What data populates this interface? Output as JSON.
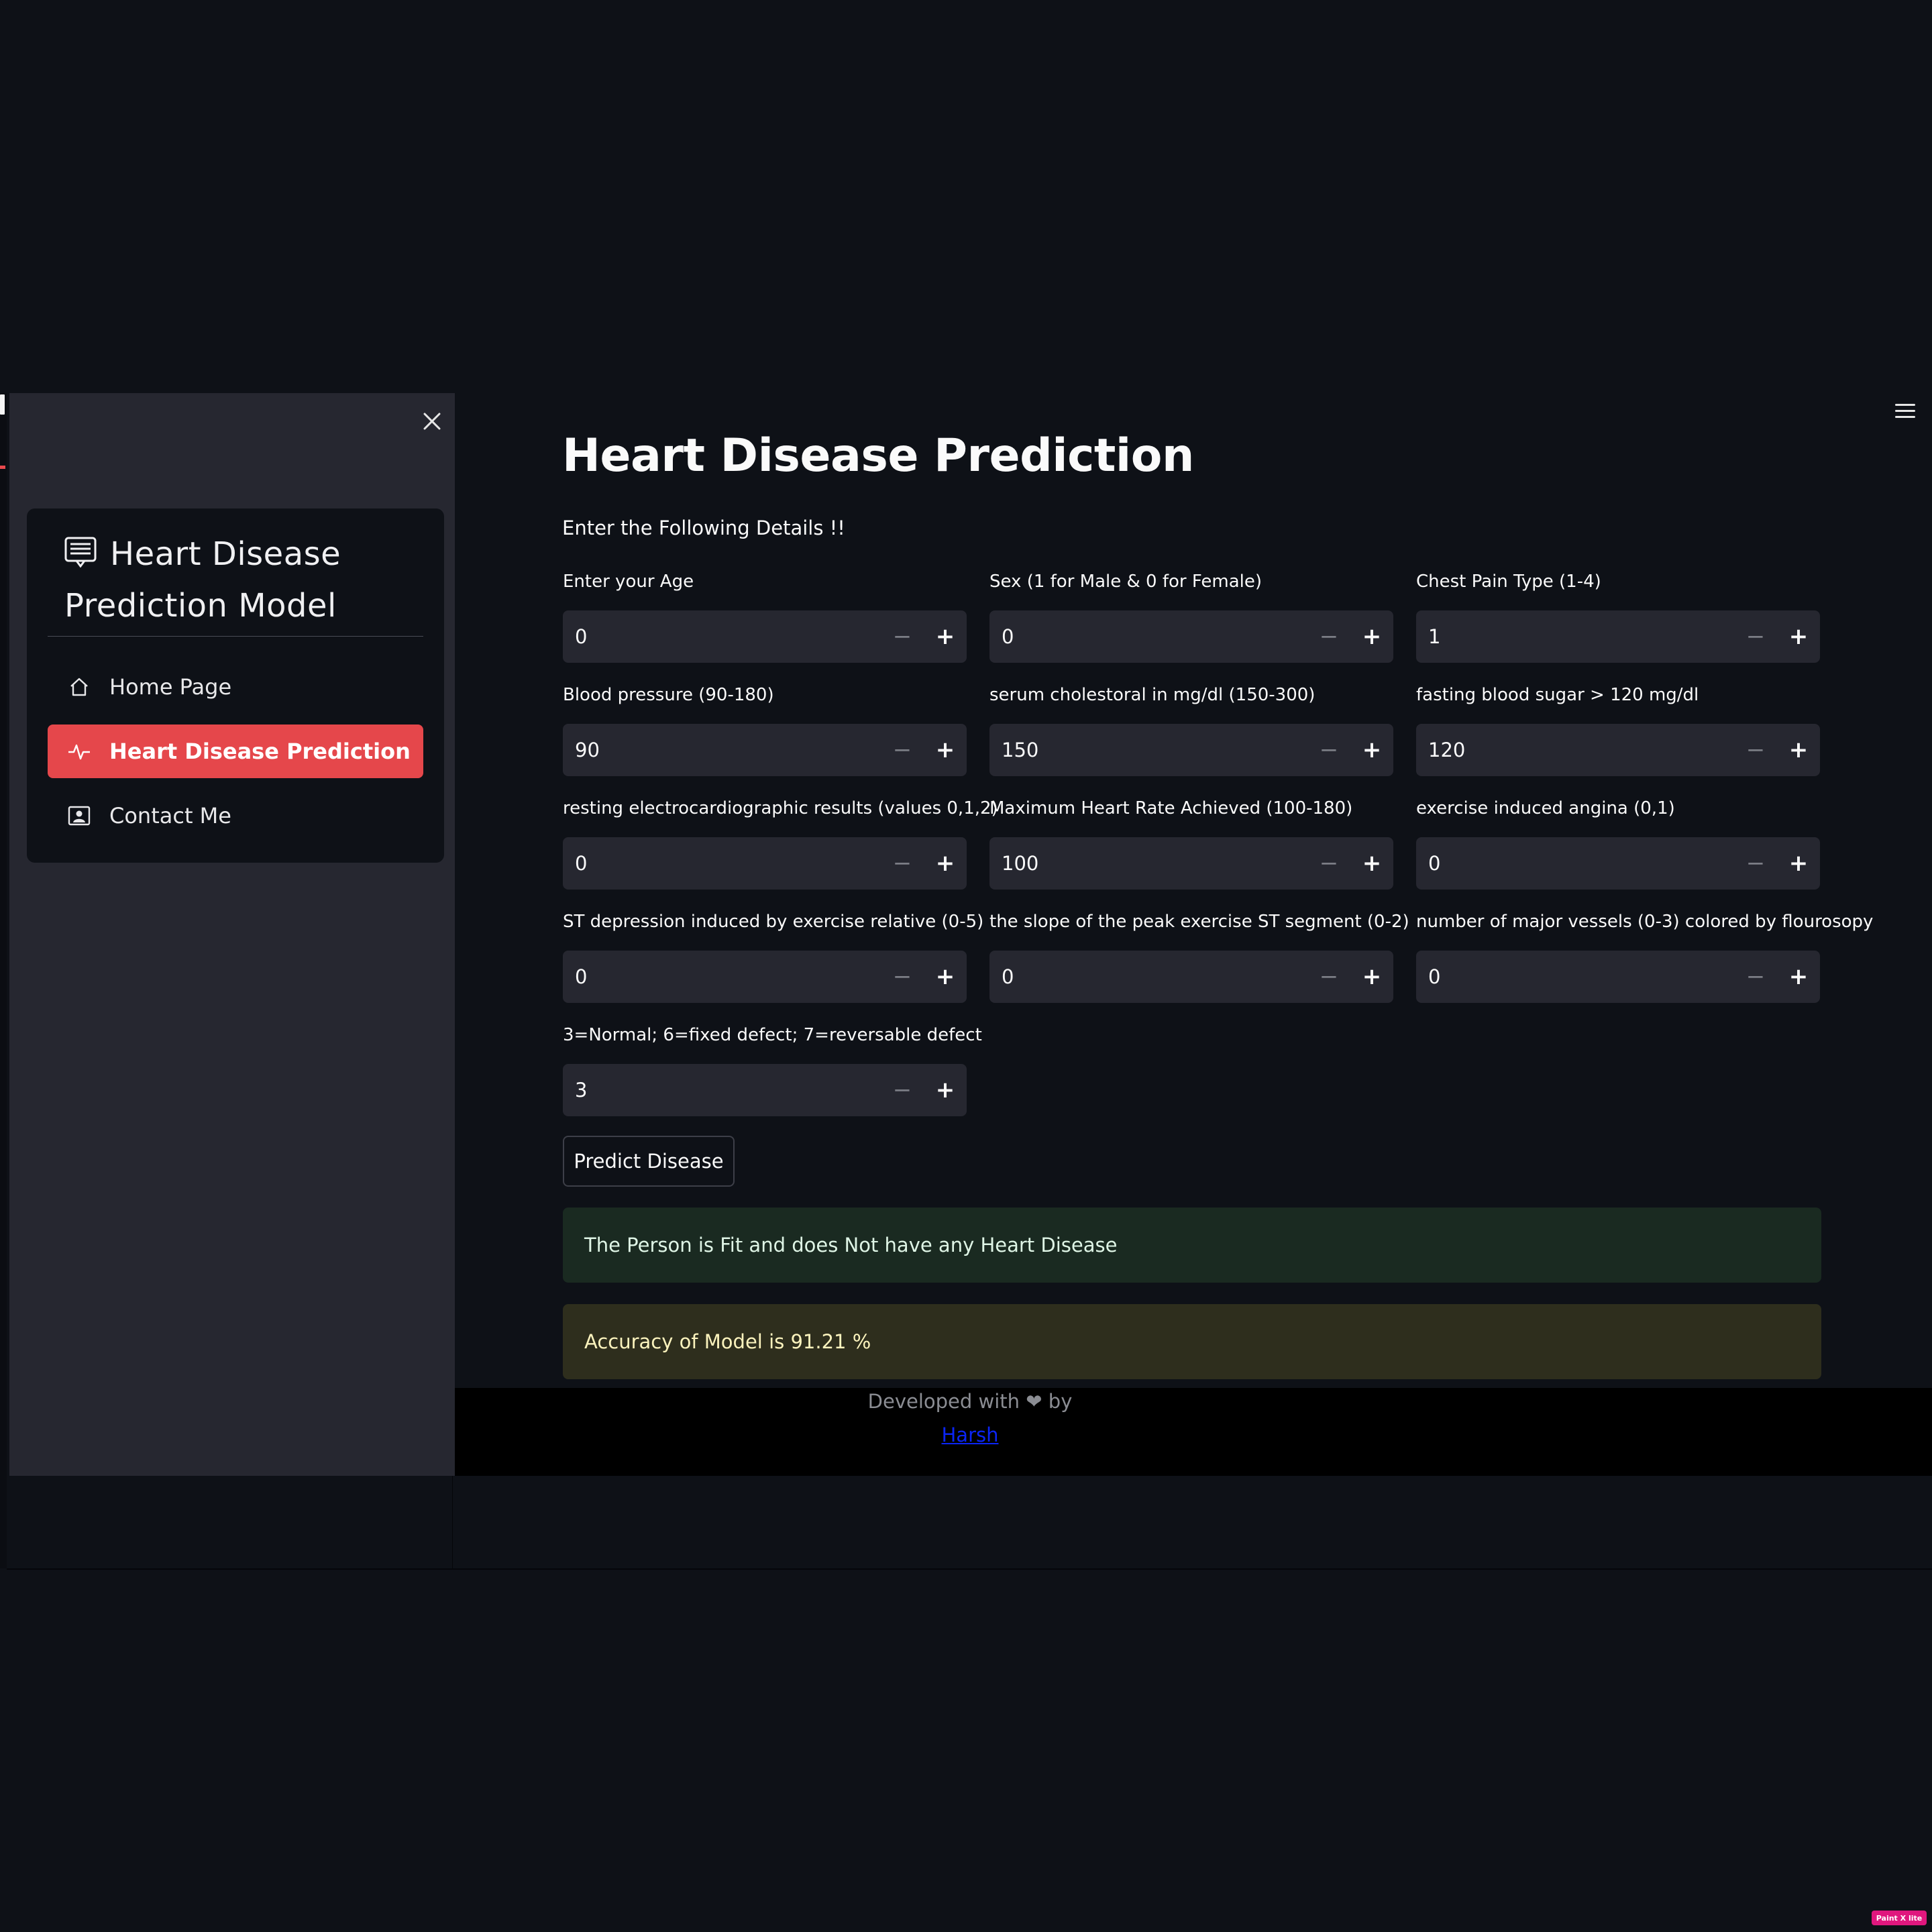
{
  "sidebar": {
    "title": "Heart Disease Prediction Model",
    "items": [
      {
        "label": "Home Page",
        "icon": "house-icon"
      },
      {
        "label": "Heart Disease Prediction",
        "icon": "pulse-icon",
        "active": true
      },
      {
        "label": "Contact Me",
        "icon": "person-badge-icon"
      }
    ],
    "accent_color": "#e5474b"
  },
  "main": {
    "title": "Heart Disease Prediction",
    "subtitle": "Enter the Following Details !!",
    "fields": [
      {
        "label": "Enter your Age",
        "value": "0"
      },
      {
        "label": "Sex (1 for Male & 0 for Female)",
        "value": "0"
      },
      {
        "label": "Chest Pain Type (1-4)",
        "value": "1"
      },
      {
        "label": "Blood pressure (90-180)",
        "value": "90"
      },
      {
        "label": "serum cholestoral in mg/dl (150-300)",
        "value": "150"
      },
      {
        "label": "fasting blood sugar > 120 mg/dl",
        "value": "120"
      },
      {
        "label": "resting electrocardiographic results (values 0,1,2)",
        "value": "0"
      },
      {
        "label": "Maximum Heart Rate Achieved (100-180)",
        "value": "100"
      },
      {
        "label": "exercise induced angina (0,1)",
        "value": "0"
      },
      {
        "label": "ST depression induced by exercise relative (0-5)",
        "value": "0"
      },
      {
        "label": "the slope of the peak exercise ST segment (0-2)",
        "value": "0"
      },
      {
        "label": "number of major vessels (0-3) colored by flourosopy",
        "value": "0"
      },
      {
        "label": "3=Normal; 6=fixed defect; 7=reversable defect",
        "value": "3"
      }
    ],
    "stepper": {
      "minus": "−",
      "plus": "+"
    },
    "predict_button": "Predict Disease",
    "result_message": "The Person is Fit and does Not have any Heart Disease",
    "accuracy_message": "Accuracy of Model is 91.21 %"
  },
  "footer": {
    "text_before": "Developed with",
    "heart": "❤",
    "text_after": "by",
    "link_text": "Harsh"
  },
  "badge": "Paint X lite"
}
